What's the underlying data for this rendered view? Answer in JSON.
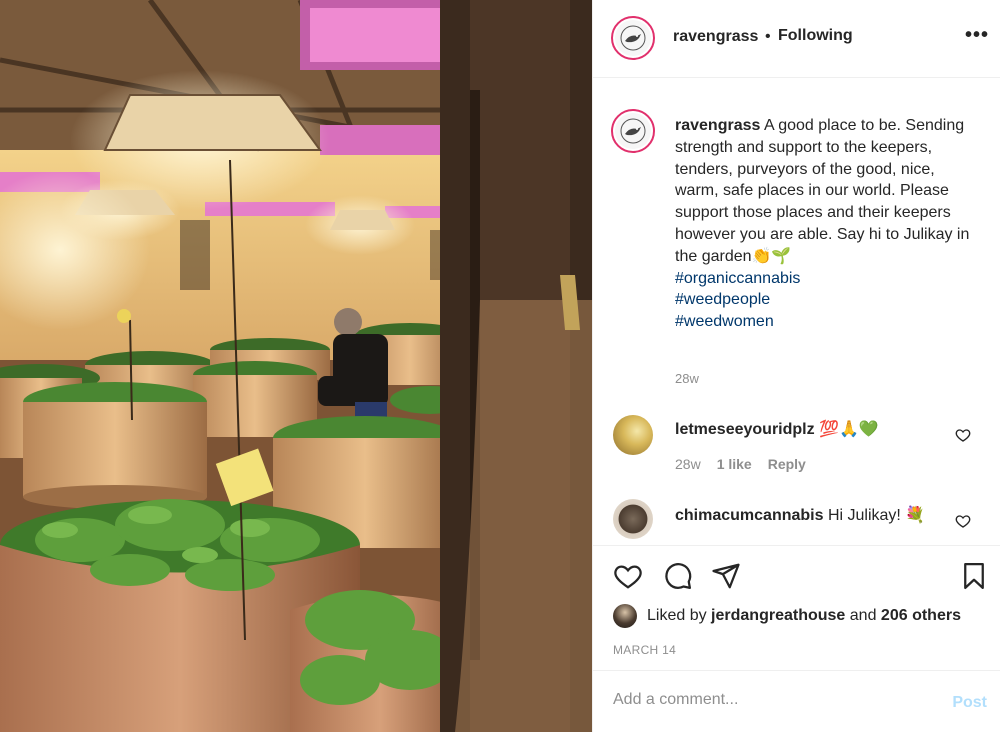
{
  "post": {
    "username": "ravengrass",
    "separator": "•",
    "follow_status": "Following",
    "more_icon": "more-horizontal-icon",
    "caption": {
      "username": "ravengrass",
      "text": "A good place to be. Sending strength and support to the keepers, tenders, purveyors of the good, nice, warm, safe places in our world. Please support those places and their keepers however you are able. Say hi to Julikay in the garden👏🌱",
      "hashtags": [
        "#organiccannabis",
        "#weedpeople",
        "#weedwomen"
      ],
      "time": "28w"
    },
    "comments": [
      {
        "username": "letmeseeyouridplz",
        "text": "💯🙏💚",
        "time": "28w",
        "likes": "1 like",
        "reply": "Reply"
      },
      {
        "username": "chimacumcannabis",
        "text": "Hi Julikay! 💐"
      }
    ],
    "liked_by": {
      "prefix": "Liked by",
      "user": "jerdangreathouse",
      "and": "and",
      "others": "206 others"
    },
    "date": "MARCH 14",
    "add_comment": {
      "placeholder": "Add a comment...",
      "post_label": "Post"
    }
  },
  "colors": {
    "link": "#00376b",
    "muted": "#8e8e8e",
    "post_disabled": "#b2dffc",
    "story_ring": "#e1306c"
  }
}
